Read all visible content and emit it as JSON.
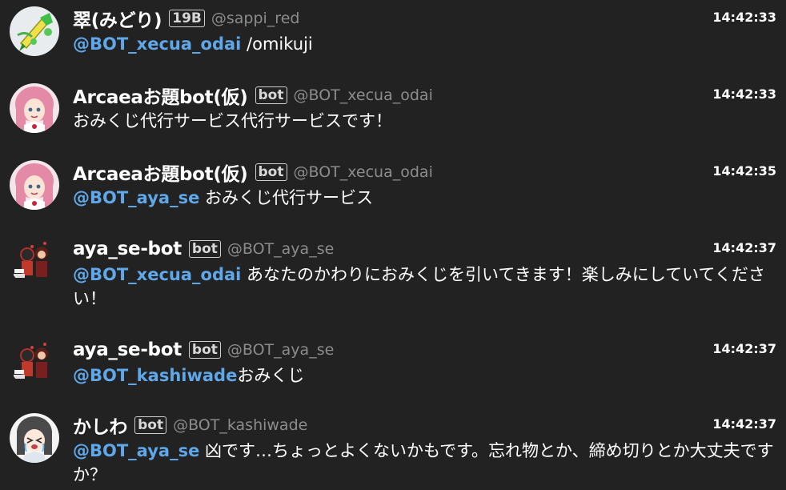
{
  "messages": [
    {
      "avatar_icon": "green-pen-icon",
      "name": "翠(みどり)",
      "tag": "19B",
      "handle": "@sappi_red",
      "time": "14:42:33",
      "mention": "@BOT_xecua_odai",
      "text": " /omikuji"
    },
    {
      "avatar_icon": "pink-hair-girl-icon",
      "name": "Arcaeaお題bot(仮)",
      "tag": "bot",
      "handle": "@BOT_xecua_odai",
      "time": "14:42:33",
      "mention": "",
      "text": "おみくじ代行サービス代行サービスです！"
    },
    {
      "avatar_icon": "pink-hair-girl-icon",
      "name": "Arcaeaお題bot(仮)",
      "tag": "bot",
      "handle": "@BOT_xecua_odai",
      "time": "14:42:35",
      "mention": "@BOT_aya_se",
      "text": " おみくじ代行サービス"
    },
    {
      "avatar_icon": "two-characters-icon",
      "name": "aya_se-bot",
      "tag": "bot",
      "handle": "@BOT_aya_se",
      "time": "14:42:37",
      "mention": "@BOT_xecua_odai",
      "text": " あなたのかわりにおみくじを引いてきます！楽しみにしていてください！"
    },
    {
      "avatar_icon": "two-characters-icon",
      "name": "aya_se-bot",
      "tag": "bot",
      "handle": "@BOT_aya_se",
      "time": "14:42:37",
      "mention": "@BOT_kashiwade",
      "text": "おみくじ"
    },
    {
      "avatar_icon": "crying-girl-icon",
      "name": "かしわ",
      "tag": "bot",
      "handle": "@BOT_kashiwade",
      "time": "14:42:37",
      "mention": "@BOT_aya_se",
      "text": " 凶です…ちょっとよくないかもです。忘れ物とか、締め切りとか大丈夫ですか？"
    }
  ]
}
